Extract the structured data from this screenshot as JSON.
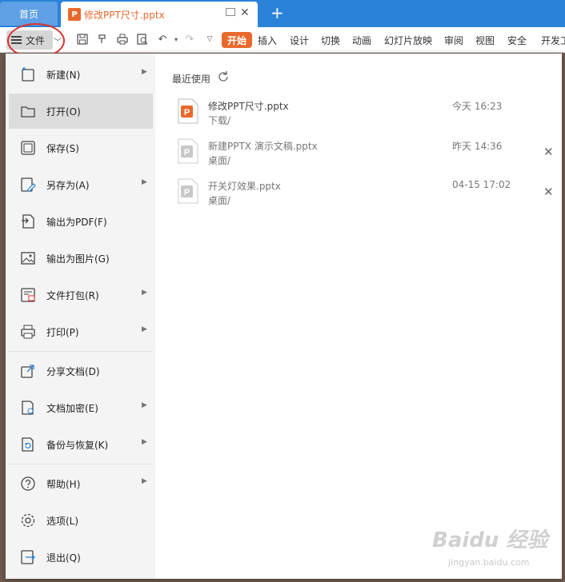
{
  "tabs": {
    "home_label": "首页",
    "doc_icon": "P",
    "doc_title": "修改PPT尺寸.pptx",
    "add_label": "+"
  },
  "toolbar": {
    "file_label": "文件",
    "start_label": "开始",
    "ribbon_tabs": [
      "插入",
      "设计",
      "切换",
      "动画",
      "幻灯片放映",
      "审阅",
      "视图",
      "安全",
      "开发工"
    ],
    "quick_icons": [
      "save-icon",
      "format-painter-icon",
      "print-icon",
      "print-preview-icon",
      "undo-icon",
      "redo-icon",
      "customize-icon"
    ]
  },
  "menu": {
    "items": [
      {
        "label": "新建(N)",
        "icon": "new-file-icon",
        "submenu": true
      },
      {
        "label": "打开(O)",
        "icon": "open-folder-icon",
        "submenu": false,
        "active": true
      },
      {
        "label": "保存(S)",
        "icon": "save-icon",
        "submenu": false
      },
      {
        "label": "另存为(A)",
        "icon": "save-as-icon",
        "submenu": true
      },
      {
        "label": "输出为PDF(F)",
        "icon": "export-pdf-icon",
        "submenu": false
      },
      {
        "label": "输出为图片(G)",
        "icon": "export-image-icon",
        "submenu": false
      },
      {
        "label": "文件打包(R)",
        "icon": "package-icon",
        "submenu": true
      },
      {
        "label": "打印(P)",
        "icon": "print-icon",
        "submenu": true
      },
      {
        "label": "分享文档(D)",
        "icon": "share-icon",
        "submenu": false
      },
      {
        "label": "文档加密(E)",
        "icon": "encrypt-icon",
        "submenu": true
      },
      {
        "label": "备份与恢复(K)",
        "icon": "backup-icon",
        "submenu": true
      },
      {
        "label": "帮助(H)",
        "icon": "help-icon",
        "submenu": true
      },
      {
        "label": "选项(L)",
        "icon": "settings-icon",
        "submenu": false
      },
      {
        "label": "退出(Q)",
        "icon": "exit-icon",
        "submenu": false
      }
    ]
  },
  "recent": {
    "title": "最近使用",
    "files": [
      {
        "name": "修改PPT尺寸.pptx",
        "path": "下载/",
        "time": "今天 16:23",
        "closable": false,
        "color": "#e9692c"
      },
      {
        "name": "新建PPTX 演示文稿.pptx",
        "path": "桌面/",
        "time": "昨天 14:36",
        "closable": true,
        "color": "#c8c8c8"
      },
      {
        "name": "开关灯效果.pptx",
        "path": "桌面/",
        "time": "04-15 17:02",
        "closable": true,
        "color": "#c8c8c8"
      }
    ]
  },
  "watermark": {
    "brand": "Baidu 经验",
    "url": "jingyan.baidu.com"
  }
}
